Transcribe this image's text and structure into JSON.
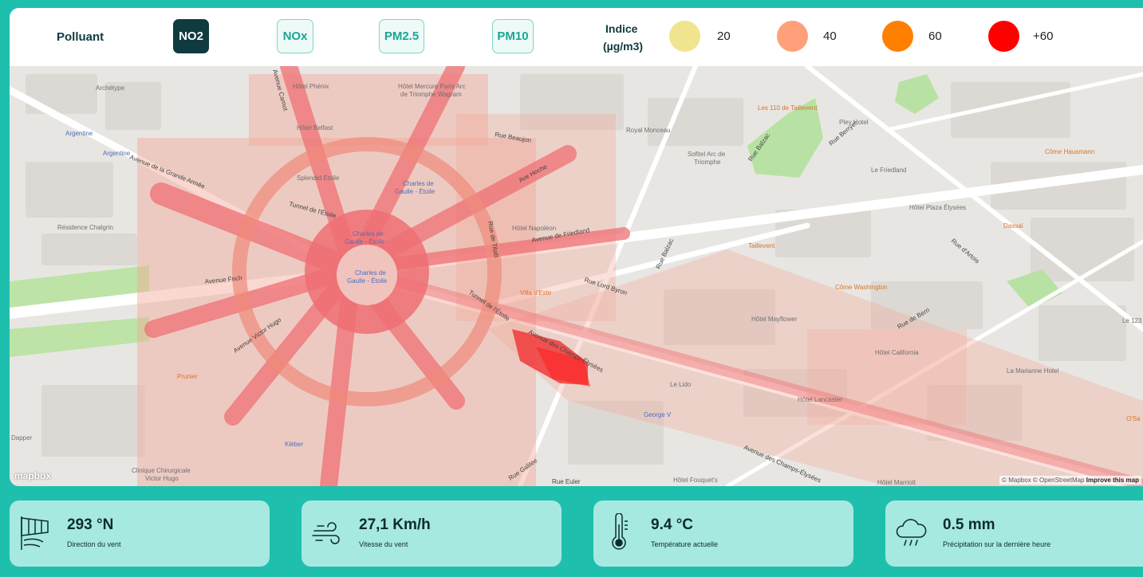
{
  "toolbar": {
    "pollutant_label": "Polluant",
    "pollutants": [
      "NO2",
      "NOx",
      "PM2.5",
      "PM10"
    ],
    "active_pollutant": "NO2",
    "index_label_line1": "Indice",
    "index_label_line2": "(µg/m3)",
    "legend": [
      {
        "value": "20",
        "color": "#f0e48e"
      },
      {
        "value": "40",
        "color": "#ffa07a"
      },
      {
        "value": "60",
        "color": "#ff7f00"
      },
      {
        "value": "+60",
        "color": "#ff0000"
      }
    ]
  },
  "map": {
    "attribution_prefix": "© Mapbox © OpenStreetMap",
    "attribution_link": "Improve this map",
    "logo": "mapbox",
    "labels": {
      "archetype": "Archétype",
      "argentine1": "Argentine",
      "argentine2": "Argentine",
      "residence": "Résidence Chalgrin",
      "hotel_phenix": "Hôtel Phénix",
      "mercure": "Hôtel Mercure Paris Arc",
      "mercure2": "de Triomphe Wagram",
      "belfast": "Hôtel Belfast",
      "splendid": "Splendid Etoile",
      "cdg1": "Charles de",
      "cdg1b": "Gaulle - Étoile",
      "cdg2": "Charles de",
      "cdg2b": "Gaulle - Étoile",
      "cdg3": "Charles de",
      "cdg3b": "Gaulle - Étoile",
      "royal": "Royal Monceau",
      "sofitel": "Sofitel Arc de",
      "sofitel2": "Triomphe",
      "les110": "Les 110 de Taillevent",
      "pley": "Pley Hotel",
      "friedland_h": "Le Friedland",
      "come_h": "Côme Hausmann",
      "plaza": "Hôtel Plaza Élysées",
      "dassai": "Dassaï",
      "taillevent": "Taillevent",
      "napoleon": "Hôtel Napoléon",
      "come_w": "Côme Washington",
      "villa": "Villa d'Este",
      "mayflower": "Hôtel Mayflower",
      "california": "Hôtel California",
      "marianne": "La Marianne Hotel",
      "lido": "Le Lido",
      "lancaster": "Hôtel Lancaster",
      "george": "George V",
      "prunier": "Prunier",
      "kleber": "Kléber",
      "clinique": "Clinique Chirurgicale",
      "clinique2": "Victor Hugo",
      "fouquet": "Hôtel Fouquet's",
      "marriott": "Hôtel Marriott",
      "dapper": "Dapper",
      "le123": "Le 123",
      "osa": "O'Sa"
    },
    "roads": {
      "grande_armee": "Avenue de la Grande Armée",
      "foch": "Avenue Foch",
      "victor_hugo": "Avenue Victor Hugo",
      "hoche": "Ave Hoche",
      "friedland": "Avenue de Friedland",
      "beaujon": "Rue Beaujon",
      "balzac": "Rue Balzac",
      "balzac2": "Rue Balzac",
      "berryer": "Rue Berryer",
      "artois": "Rue d'Artois",
      "berri": "Rue de Berri",
      "lord_byron": "Rue Lord Byron",
      "champs1": "Avenue des Champs-Élysées",
      "champs2": "Avenue des Champs-Élysées",
      "tunnel1": "Tunnel de l'Étoile",
      "tunnel2": "Tunnel de l'Étoile",
      "tilsitt": "Rue de Tilsitt",
      "carnot": "Avenue Carnot",
      "euler": "Rue Euler",
      "galilee": "Rue Galilée"
    }
  },
  "weather": [
    {
      "value": "293 °N",
      "label": "Direction du vent",
      "icon": "windsock-icon"
    },
    {
      "value": "27,1 Km/h",
      "label": "Vitesse du vent",
      "icon": "wind-icon"
    },
    {
      "value": "9.4 °C",
      "label": "Température actuelle",
      "icon": "thermometer-icon"
    },
    {
      "value": "0.5 mm",
      "label": "Précipitation sur la dernière heure",
      "icon": "rain-cloud-icon"
    }
  ]
}
